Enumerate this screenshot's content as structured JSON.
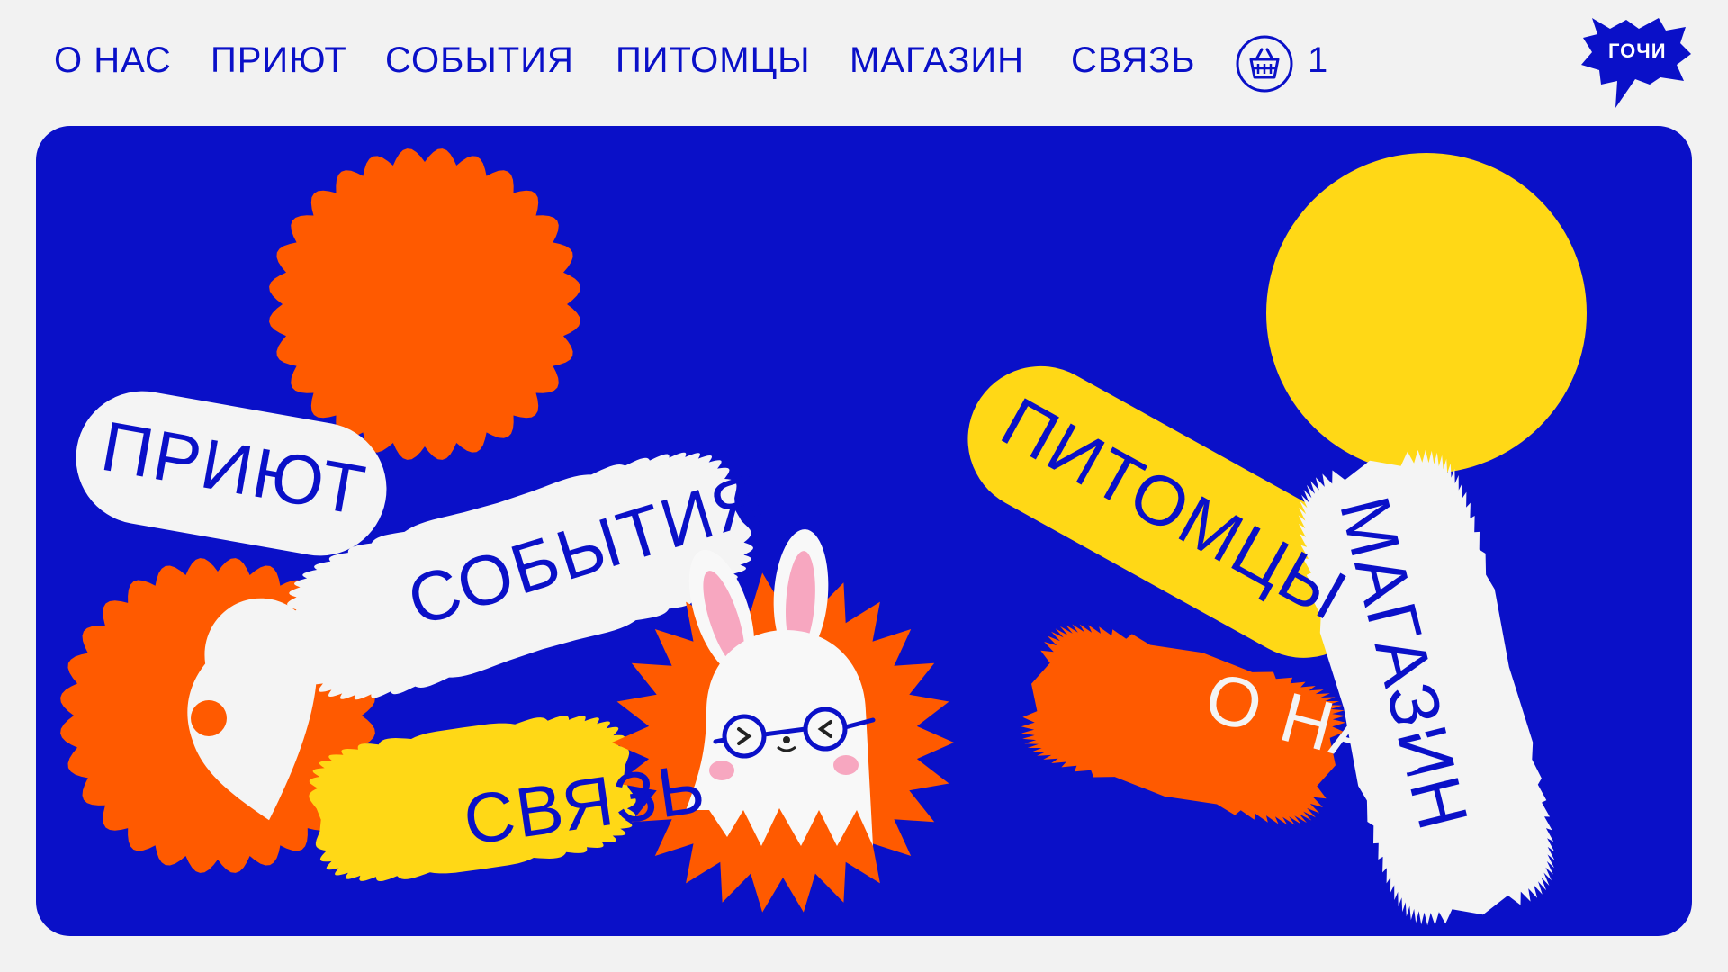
{
  "nav": {
    "items": [
      {
        "id": "nav-about",
        "label": "О НАС"
      },
      {
        "id": "nav-shelter",
        "label": "ПРИЮТ"
      },
      {
        "id": "nav-events",
        "label": "СОБЫТИЯ"
      },
      {
        "id": "nav-pets",
        "label": "ПИТОМЦЫ"
      },
      {
        "id": "nav-shop",
        "label": "МАГАЗИН"
      },
      {
        "id": "nav-contact",
        "label": "СВЯЗЬ"
      }
    ],
    "cart_icon": "basket-icon",
    "cart_count": "1"
  },
  "logo": {
    "text": "ГОЧИ",
    "icon": "speech-burst-logo"
  },
  "hero": {
    "stickers": {
      "shelter": "ПРИЮТ",
      "events": "СОБЫТИЯ",
      "pets": "ПИТОМЦЫ",
      "shop": "МАГАЗИН",
      "about": "О НАС",
      "contact": "СВЯЗЬ"
    },
    "location_icon": "location-pin-icon",
    "mascot": "bunny-mascot"
  },
  "colors": {
    "brand_blue": "#0a10c8",
    "orange": "#ff5a00",
    "yellow": "#ffd816",
    "white": "#f4f4f4",
    "background": "#f2f2f2"
  }
}
